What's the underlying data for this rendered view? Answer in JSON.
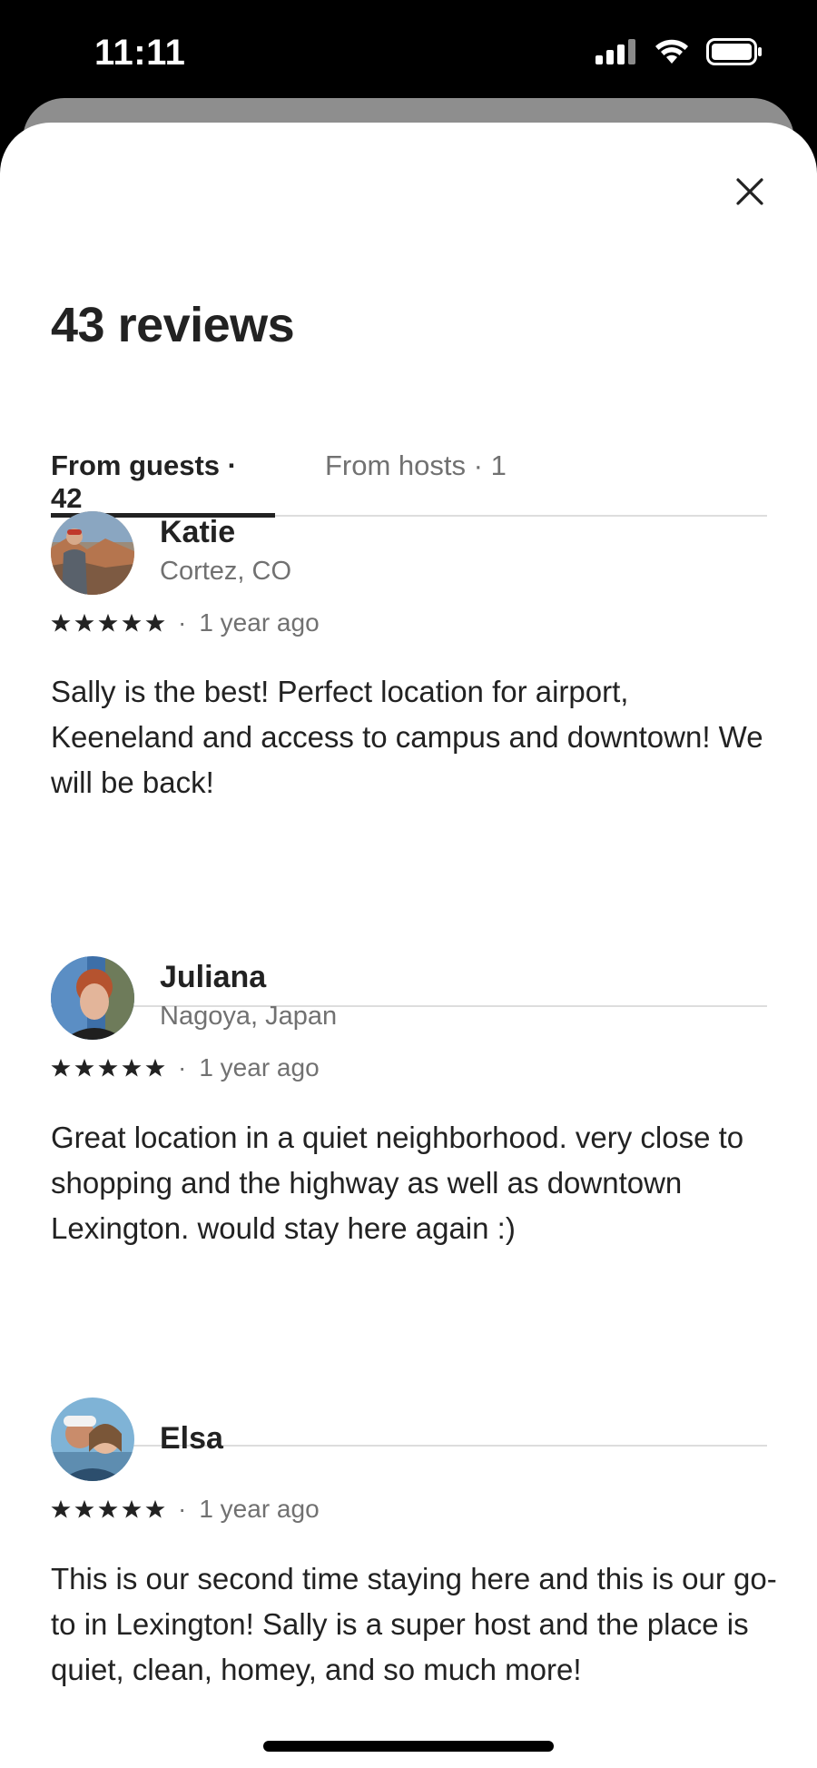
{
  "status_bar": {
    "time": "11:11"
  },
  "header": {
    "title": "43 reviews",
    "close_icon": "close-icon"
  },
  "tabs": [
    {
      "label": "From guests · 42",
      "selected": true
    },
    {
      "label": "From hosts · 1",
      "selected": false
    }
  ],
  "reviews": [
    {
      "name": "Katie",
      "location": "Cortez, CO",
      "rating": 5,
      "date": "1 year ago",
      "separator": "·",
      "text": "Sally is the best! Perfect location for airport, Keeneland and access to campus and downtown! We will be back!"
    },
    {
      "name": "Juliana",
      "location": "Nagoya, Japan",
      "rating": 5,
      "date": "1 year ago",
      "separator": "·",
      "text": "Great location in a quiet neighborhood. very close to shopping and the highway as well as downtown Lexington. would stay here again :)"
    },
    {
      "name": "Elsa",
      "location": "",
      "rating": 5,
      "date": "1 year ago",
      "separator": "·",
      "text": "This is our second time staying here and this is our go-to in Lexington! Sally is a super host and the place is quiet, clean, homey, and so much more!"
    }
  ],
  "colors": {
    "primary_text": "#222222",
    "secondary_text": "#717171",
    "divider": "#dddddd",
    "background": "#ffffff"
  }
}
